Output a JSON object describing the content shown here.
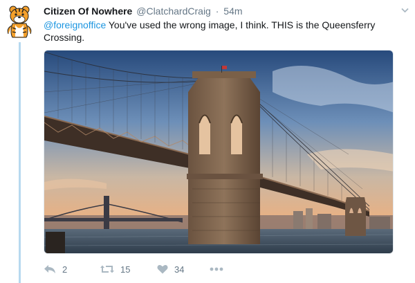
{
  "tweet": {
    "name": "Citizen Of Nowhere",
    "handle": "@ClatchardCraig",
    "separator": "·",
    "time": "54m",
    "mention": "@foreignoffice",
    "body": " You've used the wrong image, I think. THIS is the Queensferry Crossing.",
    "image_icon": "suspension-bridge-photo",
    "actions": {
      "reply_icon": "reply-icon",
      "reply_count": "2",
      "retweet_icon": "retweet-icon",
      "retweet_count": "15",
      "like_icon": "heart-icon",
      "like_count": "34",
      "more_icon": "more-icon"
    }
  },
  "colors": {
    "link": "#1b95e0",
    "thread_line": "#b7d9ef",
    "action_icon": "#aab8c2",
    "meta_text": "#657786"
  }
}
